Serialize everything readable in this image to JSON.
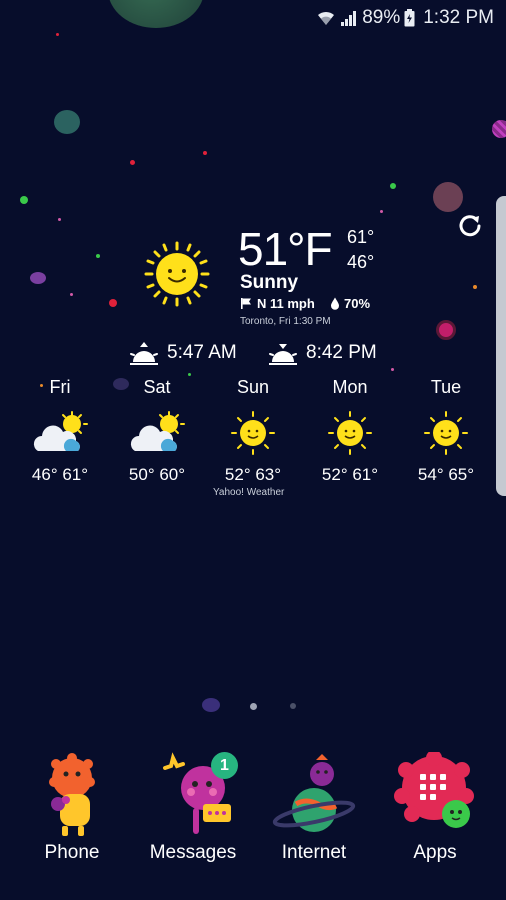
{
  "status_bar": {
    "battery": "89%",
    "time": "1:32 PM",
    "icons": [
      "wifi-icon",
      "signal-icon",
      "battery-icon"
    ]
  },
  "weather": {
    "temperature": "51°F",
    "high": "61°",
    "low": "46°",
    "condition": "Sunny",
    "wind": "N 11 mph",
    "humidity": "70%",
    "location_time": "Toronto, Fri 1:30 PM",
    "sunrise": "5:47 AM",
    "sunset": "8:42 PM",
    "credit": "Yahoo! Weather",
    "forecast": [
      {
        "day": "Fri",
        "temps": "46° 61°",
        "icon": "cloudy-sun-icon"
      },
      {
        "day": "Sat",
        "temps": "50° 60°",
        "icon": "cloudy-sun-icon"
      },
      {
        "day": "Sun",
        "temps": "52° 63°",
        "icon": "sun-icon"
      },
      {
        "day": "Mon",
        "temps": "52° 61°",
        "icon": "sun-icon"
      },
      {
        "day": "Tue",
        "temps": "54° 65°",
        "icon": "sun-icon"
      }
    ]
  },
  "dock": [
    {
      "label": "Phone",
      "icon": "phone-monster-icon"
    },
    {
      "label": "Messages",
      "icon": "messages-monster-icon",
      "badge": "1"
    },
    {
      "label": "Internet",
      "icon": "internet-planet-icon"
    },
    {
      "label": "Apps",
      "icon": "apps-monster-icon"
    }
  ],
  "colors": {
    "background": "#070d2b",
    "sun": "#ffe01a",
    "badge": "#27b580"
  }
}
